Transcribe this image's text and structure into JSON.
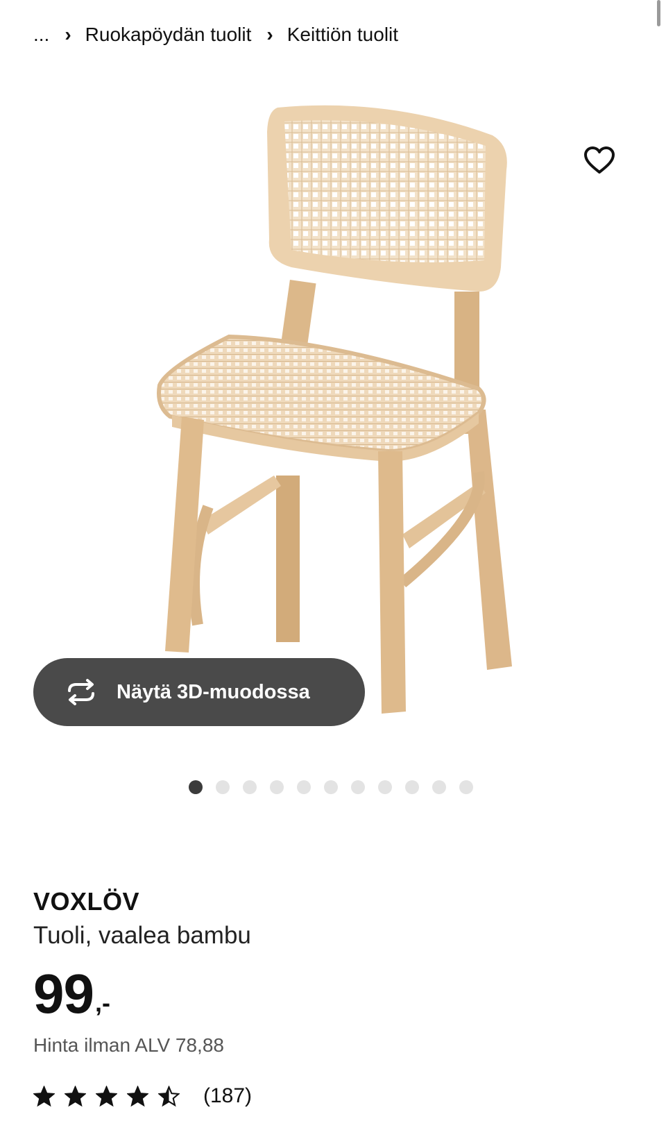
{
  "breadcrumb": {
    "ellipsis": "...",
    "items": [
      "Ruokapöydän tuolit",
      "Keittiön tuolit"
    ]
  },
  "gallery": {
    "view3d_label": "Näytä 3D-muodossa",
    "image_count": 11,
    "active_index": 0
  },
  "product": {
    "name": "VOXLÖV",
    "description": "Tuoli, vaalea bambu",
    "price": "99",
    "price_suffix": ",-",
    "vat_text": "Hinta ilman ALV 78,88",
    "rating_value": 4.5,
    "rating_max": 5,
    "review_count": "(187)"
  },
  "colors": {
    "bamboo": "#e4c49a",
    "rattan": "#f0d9bb",
    "button_dark": "#4a4a4a"
  }
}
